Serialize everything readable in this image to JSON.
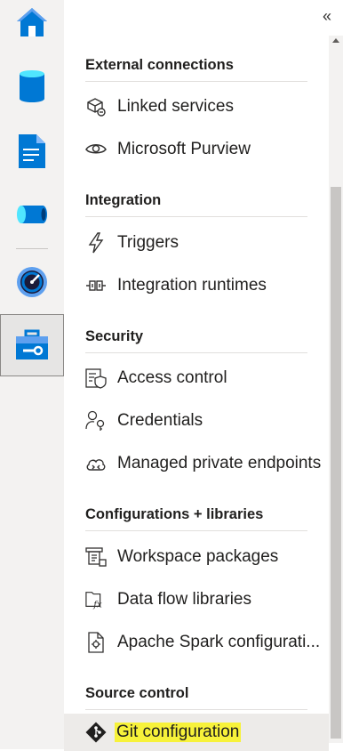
{
  "rail": {
    "items": [
      {
        "icon": "home-icon"
      },
      {
        "icon": "data-icon"
      },
      {
        "icon": "develop-icon"
      },
      {
        "icon": "integrate-icon"
      },
      {
        "icon": "monitor-icon"
      },
      {
        "icon": "manage-icon",
        "selected": true
      }
    ]
  },
  "panel": {
    "collapse_label": "«",
    "sections": [
      {
        "title": "External connections",
        "items": [
          {
            "label": "Linked services",
            "icon": "linked-services-icon"
          },
          {
            "label": "Microsoft Purview",
            "icon": "purview-eye-icon"
          }
        ]
      },
      {
        "title": "Integration",
        "items": [
          {
            "label": "Triggers",
            "icon": "trigger-bolt-icon"
          },
          {
            "label": "Integration runtimes",
            "icon": "integration-runtime-icon"
          }
        ]
      },
      {
        "title": "Security",
        "items": [
          {
            "label": "Access control",
            "icon": "access-control-icon"
          },
          {
            "label": "Credentials",
            "icon": "credentials-icon"
          },
          {
            "label": "Managed private endpoints",
            "icon": "cloud-endpoint-icon"
          }
        ]
      },
      {
        "title": "Configurations + libraries",
        "items": [
          {
            "label": "Workspace packages",
            "icon": "workspace-packages-icon"
          },
          {
            "label": "Data flow libraries",
            "icon": "data-flow-libraries-icon"
          },
          {
            "label": "Apache Spark configurati...",
            "icon": "spark-config-icon"
          }
        ]
      },
      {
        "title": "Source control",
        "items": [
          {
            "label": "Git configuration",
            "icon": "git-icon"
          }
        ]
      }
    ]
  },
  "colors": {
    "accent_blue": "#0078d4",
    "highlight_yellow": "#f7f23a"
  }
}
